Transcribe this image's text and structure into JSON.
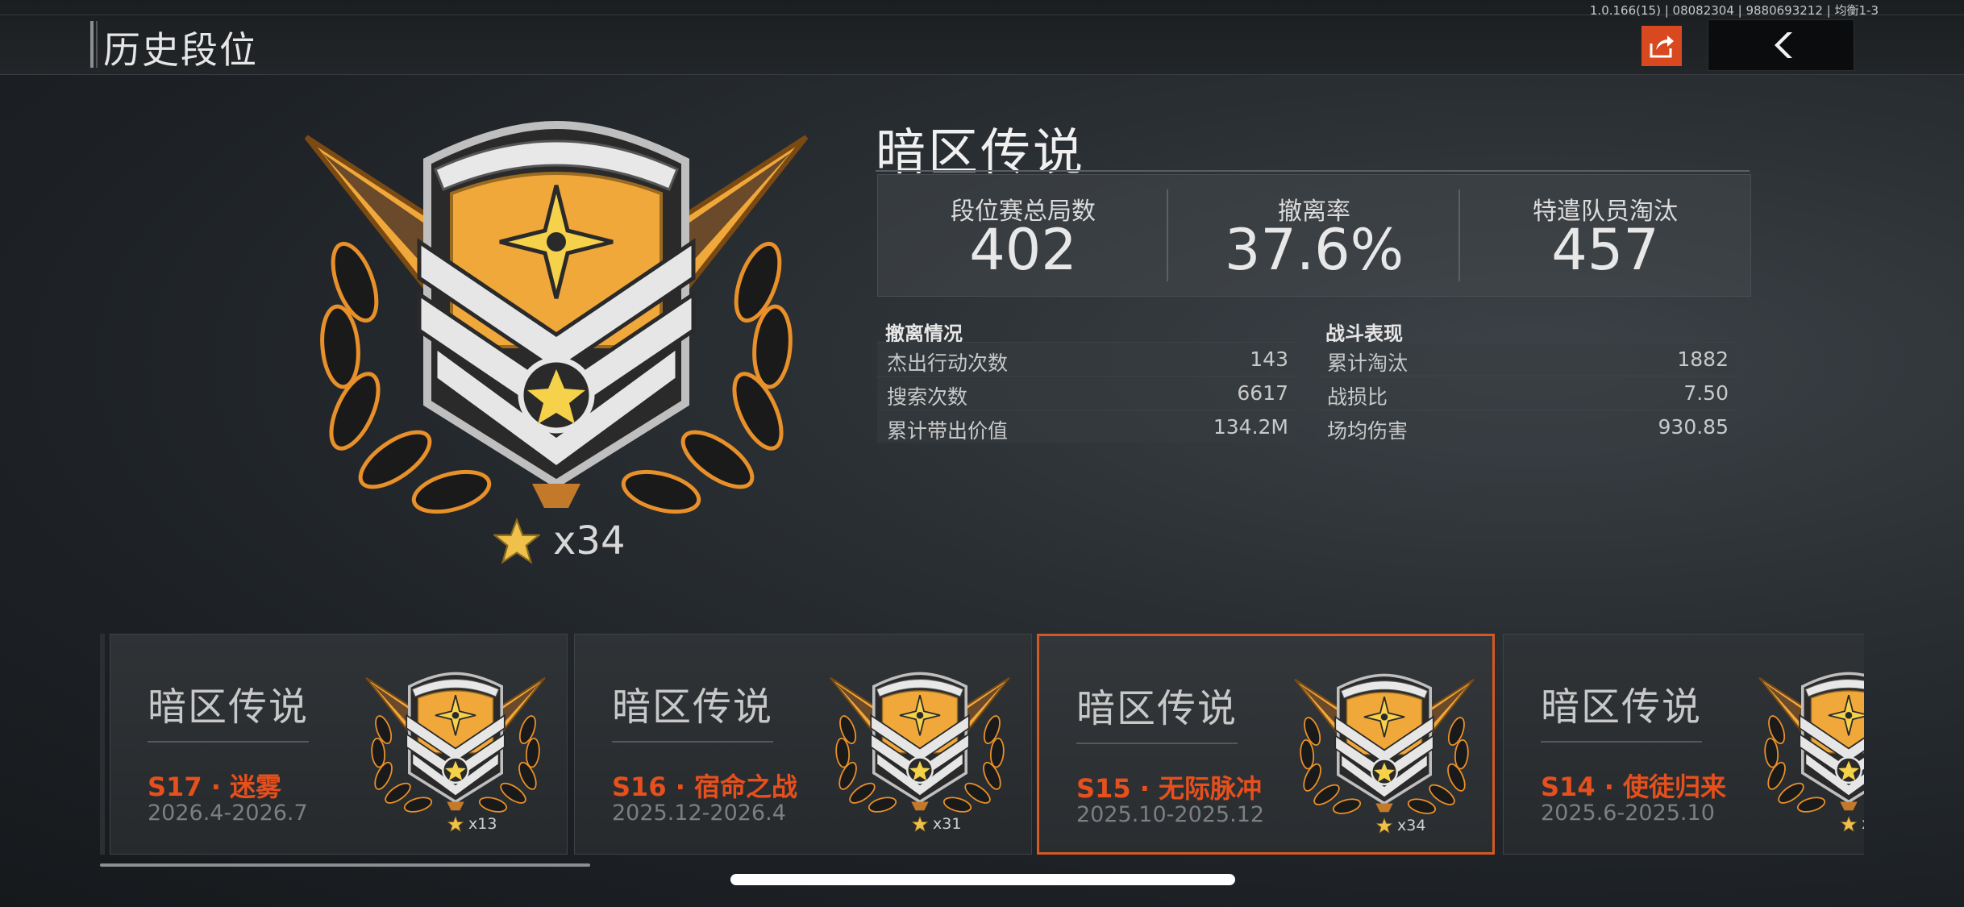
{
  "header": {
    "title": "历史段位",
    "version": "1.0.166(15) | 08082304 | 9880693212 | 均衡1-3",
    "share_icon": "share-icon",
    "back_icon": "chevron-left-icon"
  },
  "current": {
    "rank_name": "暗区传说",
    "star_count": "x34",
    "stats": [
      {
        "label": "段位赛总局数",
        "value": "402"
      },
      {
        "label": "撤离率",
        "value": "37.6%"
      },
      {
        "label": "特遣队员淘汰",
        "value": "457"
      }
    ],
    "evac": {
      "title": "撤离情况",
      "rows": [
        {
          "label": "杰出行动次数",
          "value": "143"
        },
        {
          "label": "搜索次数",
          "value": "6617"
        },
        {
          "label": "累计带出价值",
          "value": "134.2M"
        }
      ]
    },
    "combat": {
      "title": "战斗表现",
      "rows": [
        {
          "label": "累计淘汰",
          "value": "1882"
        },
        {
          "label": "战损比",
          "value": "7.50"
        },
        {
          "label": "场均伤害",
          "value": "930.85"
        }
      ]
    }
  },
  "seasons": [
    {
      "rank": "暗区传说",
      "season": "S17 · 迷雾",
      "dates": "2026.4-2026.7",
      "stars": "x13"
    },
    {
      "rank": "暗区传说",
      "season": "S16 · 宿命之战",
      "dates": "2025.12-2026.4",
      "stars": "x31"
    },
    {
      "rank": "暗区传说",
      "season": "S15 · 无际脉冲",
      "dates": "2025.10-2025.12",
      "stars": "x34"
    },
    {
      "rank": "暗区传说",
      "season": "S14 · 使徒归来",
      "dates": "2025.6-2025.10",
      "stars": "x"
    }
  ],
  "colors": {
    "accent": "#e5501d",
    "gold": "#f0a83a",
    "silver": "#dcdcdc"
  }
}
